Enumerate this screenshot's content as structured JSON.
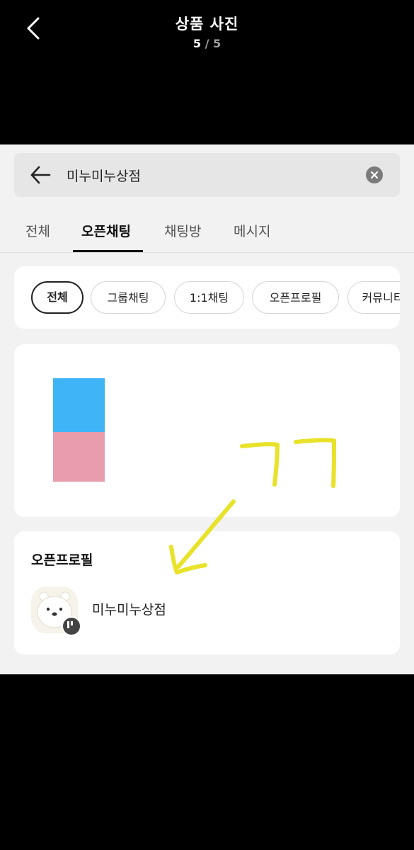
{
  "viewer": {
    "title": "상품 사진",
    "page_current": "5",
    "page_separator": "/",
    "page_total": "5",
    "back_icon": "chevron-left-icon"
  },
  "screenshot": {
    "search": {
      "query": "미누미누상점",
      "back_icon": "arrow-left-icon",
      "clear_icon": "clear-circle-icon"
    },
    "tabs": [
      "전체",
      "오픈채팅",
      "채팅방",
      "메시지"
    ],
    "active_tab": "오픈채팅",
    "filter_chips": [
      "전체",
      "그룹채팅",
      "1:1채팅",
      "오픈프로필",
      "커뮤니티"
    ],
    "active_chip": "전체",
    "open_profile_section": {
      "title": "오픈프로필",
      "name": "미누미누상점",
      "avatar_icon": "bear-avatar-icon"
    },
    "annotation": {
      "handwritten_text": "ㄱㄱ",
      "arrow_icon": "arrow-down-left-icon",
      "color": "#e8e22a"
    },
    "color_swatches": [
      "#3fb4f6",
      "#e99cab"
    ]
  }
}
